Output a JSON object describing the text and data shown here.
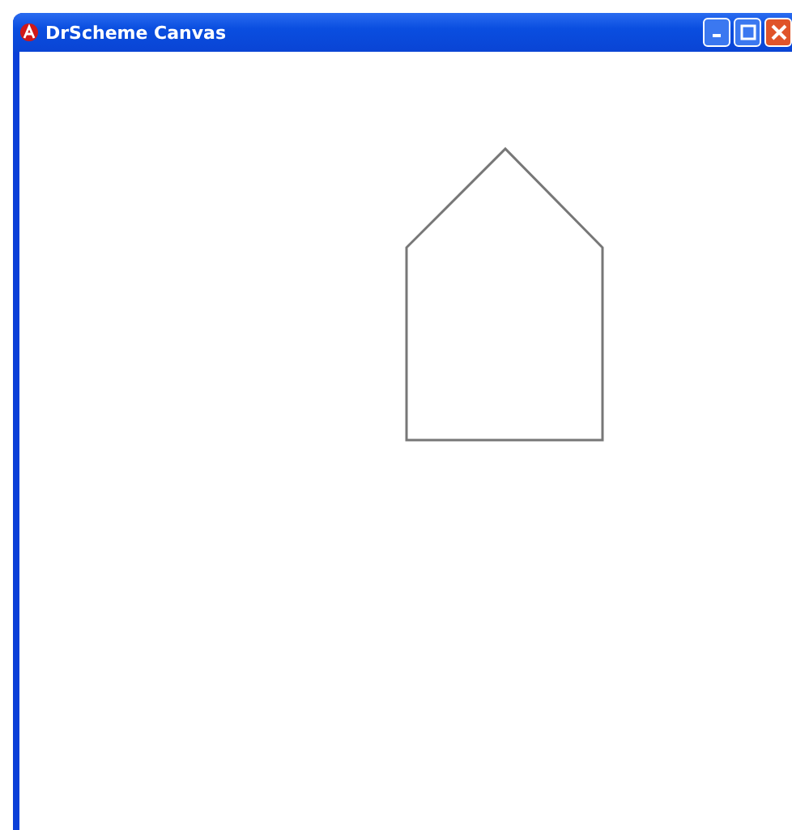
{
  "window": {
    "title": "DrScheme Canvas"
  },
  "canvas": {
    "shapes": [
      {
        "kind": "polygon"
      }
    ]
  }
}
